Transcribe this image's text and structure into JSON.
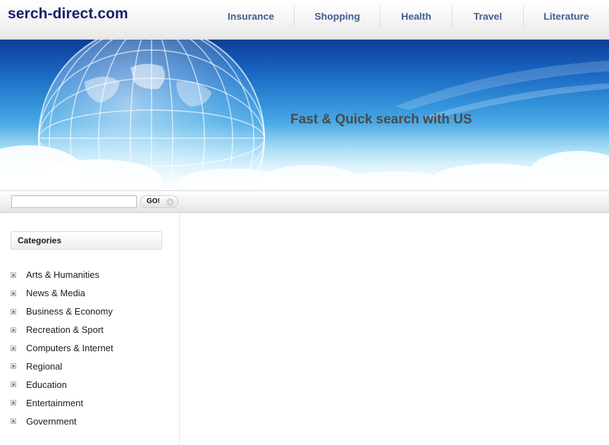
{
  "header": {
    "logo": "serch-direct.com",
    "nav": [
      {
        "label": "Insurance"
      },
      {
        "label": "Shopping"
      },
      {
        "label": "Health"
      },
      {
        "label": "Travel"
      },
      {
        "label": "Literature"
      }
    ]
  },
  "banner": {
    "tagline": "Fast & Quick search with US"
  },
  "search": {
    "value": "",
    "go_label": "GO!",
    "go_icon": "close-circle-icon"
  },
  "sidebar": {
    "title": "Categories",
    "items": [
      {
        "label": "Arts & Humanities"
      },
      {
        "label": "News & Media"
      },
      {
        "label": "Business & Economy"
      },
      {
        "label": "Recreation & Sport"
      },
      {
        "label": "Computers & Internet"
      },
      {
        "label": "Regional"
      },
      {
        "label": "Education"
      },
      {
        "label": "Entertainment"
      },
      {
        "label": "Government"
      }
    ]
  },
  "colors": {
    "logo": "#16206e",
    "nav": "#3f5e92",
    "banner_top": "#0b3e98",
    "banner_bottom": "#d4f2fb",
    "tagline": "#4a4a4a"
  }
}
